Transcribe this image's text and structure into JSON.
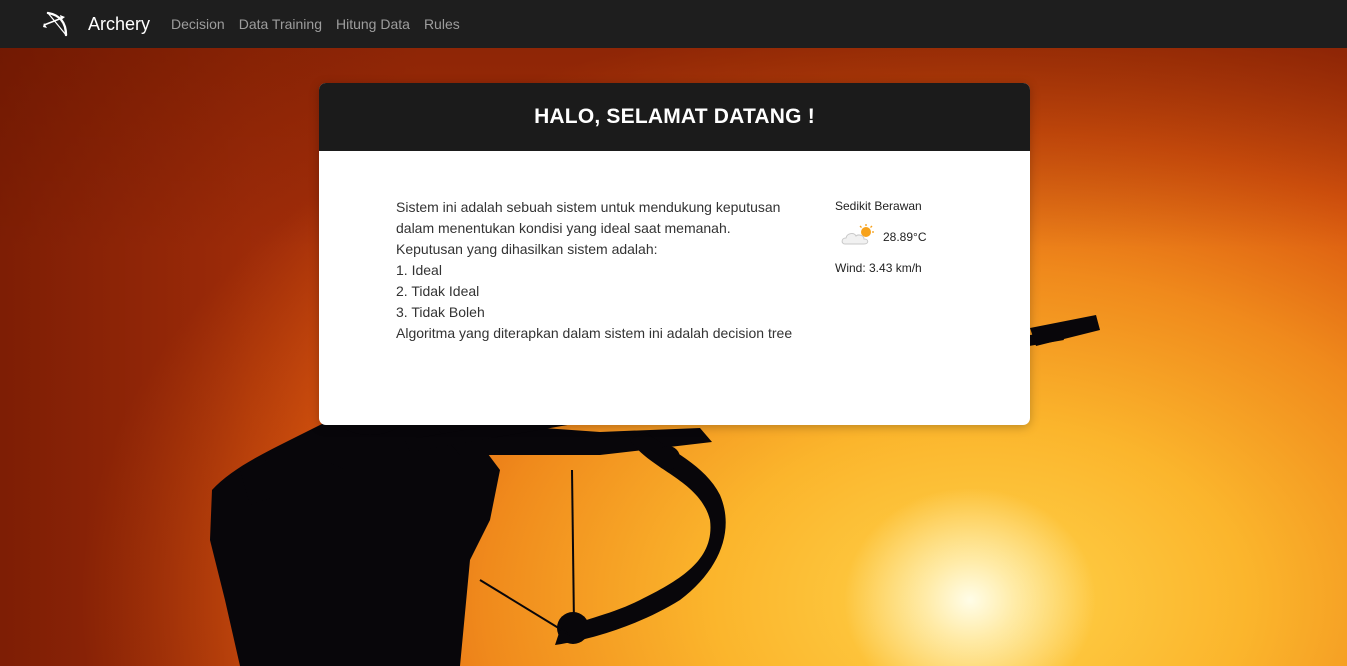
{
  "navbar": {
    "brand": "Archery",
    "links": [
      "Decision",
      "Data Training",
      "Hitung Data",
      "Rules"
    ]
  },
  "card": {
    "title": "HALO, SELAMAT DATANG !",
    "description": [
      "Sistem ini adalah sebuah sistem untuk mendukung keputusan",
      "dalam menentukan kondisi yang ideal saat memanah.",
      "Keputusan yang dihasilkan sistem adalah:",
      "1. Ideal",
      "2. Tidak Ideal",
      "3. Tidak Boleh",
      "Algoritma yang diterapkan dalam sistem ini adalah decision tree"
    ]
  },
  "weather": {
    "condition": "Sedikit Berawan",
    "temperature": "28.89°C",
    "wind": "Wind: 3.43 km/h",
    "icon": "partly-cloudy-icon"
  },
  "colors": {
    "navbar_bg": "#1e1e1e",
    "nav_link": "#9d9d9d",
    "card_header_bg": "#1b1b1b",
    "sunset_orange": "#f08a1c"
  }
}
